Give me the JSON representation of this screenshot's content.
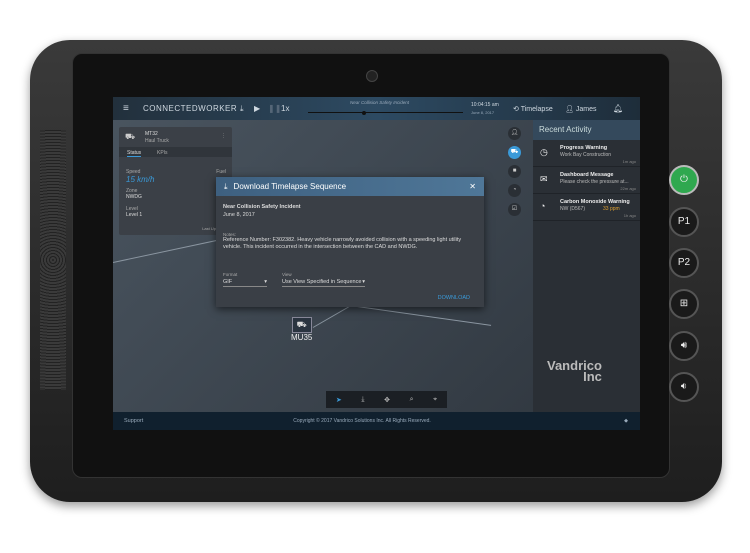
{
  "topbar": {
    "app_name": "CONNECTEDWORKER",
    "speed": "1x",
    "sequence_title": "Near Collision Safety Incident",
    "time": "10:04:15 am",
    "date": "June 8, 2017",
    "timelapse_label": "Timelapse",
    "user": "James",
    "timeline_progress": 0.35
  },
  "vehicle_card": {
    "id": "MT32",
    "type": "Haul Truck",
    "tabs": [
      "Status",
      "KPIs"
    ],
    "speed_label": "Speed",
    "speed": "15 km/h",
    "fuel_label": "Fuel",
    "zone_label": "Zone",
    "zone": "NWDG",
    "level_label": "Level",
    "level": "Level 1",
    "last_updated_label": "Last Updated"
  },
  "map": {
    "marker_label": "MU35"
  },
  "dialog": {
    "title": "Download Timelapse Sequence",
    "incident": "Near Collision Safety Incident",
    "date": "June 8, 2017",
    "notes_label": "Notes:",
    "notes": "Reference Number: F302382. Heavy vehicle narrowly avoided collision with a speeding light utility vehicle. This incident occurred in the intersection between the CAD and NWDG.",
    "format_label": "Format",
    "format_value": "GIF",
    "view_label": "View",
    "view_value": "Use View Specified in Sequence",
    "download_label": "DOWNLOAD"
  },
  "recent_activity": {
    "title": "Recent Activity",
    "items": [
      {
        "icon": "clock-icon",
        "title": "Progress Warning",
        "subtitle": "Work Bay Construction",
        "value": "",
        "time": "1m ago"
      },
      {
        "icon": "envelope-icon",
        "title": "Dashboard Message",
        "subtitle": "Please check the pressure at...",
        "value": "",
        "time": "22m ago"
      },
      {
        "icon": "gauge-icon",
        "title": "Carbon Monoxide Warning",
        "subtitle": "NW (D567)",
        "value": "33 ppm",
        "time": "1h ago"
      }
    ]
  },
  "watermark": {
    "line1": "Vandrico",
    "line2": "Inc"
  },
  "footer": {
    "support": "Support",
    "copyright": "Copyright © 2017 Vandrico Solutions Inc. All Rights Reserved."
  },
  "hardware_buttons": [
    "P1",
    "P2"
  ],
  "colors": {
    "accent": "#3a9ad9",
    "warning": "#e0a030",
    "power": "#2fa84f"
  }
}
